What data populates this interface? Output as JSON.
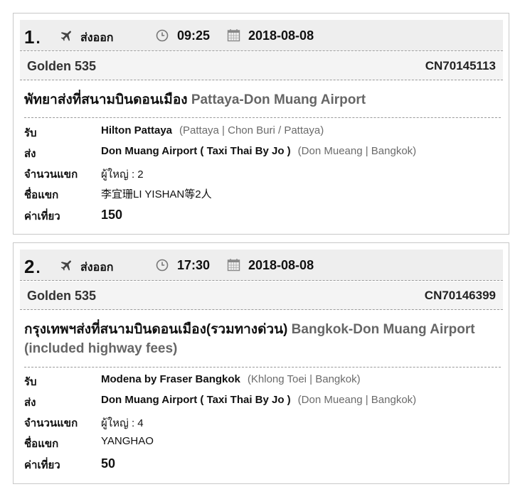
{
  "bookings": [
    {
      "index": "1",
      "direction": "ส่งออก",
      "time": "09:25",
      "date": "2018-08-08",
      "company": "Golden 535",
      "code": "CN70145113",
      "route_th": "พัทยาส่งที่สนามบินดอนเมือง",
      "route_en": "Pattaya-Don Muang Airport",
      "pickup_label": "รับ",
      "pickup_name": "Hilton Pattaya",
      "pickup_area": "(Pattaya | Chon Buri / Pattaya)",
      "dropoff_label": "ส่ง",
      "dropoff_name": "Don Muang Airport ( Taxi Thai By Jo )",
      "dropoff_area": "(Don Mueang | Bangkok)",
      "pax_label": "จำนวนแขก",
      "pax_value": "ผู้ใหญ่ : 2",
      "guest_label": "ชื่อแขก",
      "guest_value": "李宜珊LI YISHAN等2人",
      "fare_label": "ค่าเที่ยว",
      "fare_value": "150"
    },
    {
      "index": "2",
      "direction": "ส่งออก",
      "time": "17:30",
      "date": "2018-08-08",
      "company": "Golden 535",
      "code": "CN70146399",
      "route_th": "กรุงเทพฯส่งที่สนามบินดอนเมือง(รวมทางด่วน)",
      "route_en": "Bangkok-Don Muang Airport (included highway fees)",
      "pickup_label": "รับ",
      "pickup_name": "Modena by Fraser Bangkok",
      "pickup_area": "(Khlong Toei | Bangkok)",
      "dropoff_label": "ส่ง",
      "dropoff_name": "Don Muang Airport ( Taxi Thai By Jo )",
      "dropoff_area": "(Don Mueang | Bangkok)",
      "pax_label": "จำนวนแขก",
      "pax_value": "ผู้ใหญ่ : 4",
      "guest_label": "ชื่อแขก",
      "guest_value": "YANGHAO",
      "fare_label": "ค่าเที่ยว",
      "fare_value": "50"
    }
  ],
  "icons": {
    "direction": "plane-icon",
    "time": "clock-icon",
    "date": "calendar-icon"
  },
  "colors": {
    "header_bg": "#eeeeee",
    "subheader_bg": "#f4f4f4",
    "muted_text": "#666666"
  }
}
